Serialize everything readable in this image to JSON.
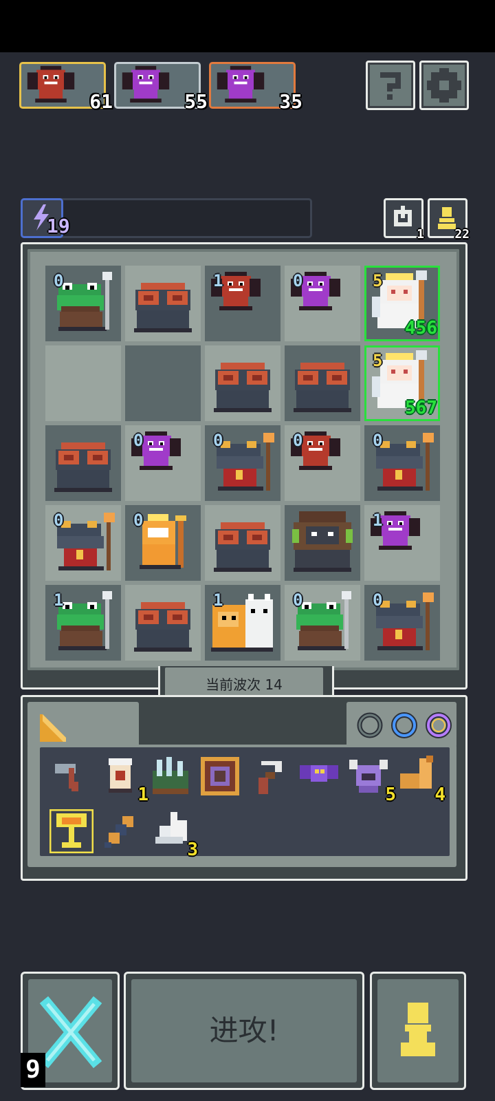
{
  "enemies": [
    {
      "count": "61",
      "ring": "#e7c24a",
      "type": "red-dragon"
    },
    {
      "count": "55",
      "ring": "#c3ccd1",
      "type": "purple-dragon"
    },
    {
      "count": "35",
      "ring": "#e27a3e",
      "type": "purple-dragon"
    }
  ],
  "top_buttons": {
    "help_icon": "question-icon",
    "settings_icon": "gear-icon"
  },
  "energy": {
    "value": "19",
    "icon": "lightning-icon"
  },
  "reroll": {
    "count": "1",
    "icon": "refresh-icon"
  },
  "pawns": {
    "count": "22",
    "icon": "pawn-icon"
  },
  "board": {
    "rows": [
      [
        {
          "unit": "green-frog",
          "lvl": "0"
        },
        {
          "unit": "red-toad"
        },
        {
          "unit": "red-dragon",
          "lvl": "1"
        },
        {
          "unit": "purple-dragon",
          "lvl": "0"
        },
        {
          "unit": "angel",
          "lvl": "5",
          "hp": "456"
        }
      ],
      [
        {
          "unit": "empty"
        },
        {
          "unit": "empty"
        },
        {
          "unit": "red-toad"
        },
        {
          "unit": "red-toad"
        },
        {
          "unit": "angel",
          "lvl": "5",
          "hp": "567"
        }
      ],
      [
        {
          "unit": "red-toad"
        },
        {
          "unit": "purple-dragon",
          "lvl": "0"
        },
        {
          "unit": "frog-mage",
          "lvl": "0"
        },
        {
          "unit": "red-dragon",
          "lvl": "0"
        },
        {
          "unit": "frog-mage",
          "lvl": "0"
        }
      ],
      [
        {
          "unit": "frog-mage",
          "lvl": "0"
        },
        {
          "unit": "cat-king",
          "lvl": "0"
        },
        {
          "unit": "red-toad"
        },
        {
          "unit": "rock-golem"
        },
        {
          "unit": "purple-dragon",
          "lvl": "1"
        }
      ],
      [
        {
          "unit": "green-frog",
          "lvl": "1"
        },
        {
          "unit": "red-toad"
        },
        {
          "unit": "lion-duo",
          "lvl": "1"
        },
        {
          "unit": "green-frog",
          "lvl": "0"
        },
        {
          "unit": "frog-mage",
          "lvl": "0"
        }
      ]
    ]
  },
  "wave_label": "当前波次 14",
  "inventory": {
    "tab_icon": "triangle-ruler-icon",
    "filter_icons": [
      "dark-ring-icon",
      "blue-ring-icon",
      "purple-ring-icon"
    ],
    "items": [
      {
        "icon": "hammer-icon",
        "count": ""
      },
      {
        "icon": "tower-icon",
        "count": "1"
      },
      {
        "icon": "crystal-field-icon",
        "count": ""
      },
      {
        "icon": "orb-frame-icon",
        "count": ""
      },
      {
        "icon": "slingshot-icon",
        "count": ""
      },
      {
        "icon": "bat-icon",
        "count": ""
      },
      {
        "icon": "horned-helm-icon",
        "count": "5"
      },
      {
        "icon": "horn-icon",
        "count": "4"
      },
      {
        "icon": "goblet-icon",
        "count": ""
      },
      {
        "icon": "feather-icon",
        "count": ""
      },
      {
        "icon": "wings-icon",
        "count": "3"
      }
    ]
  },
  "attack_label": "进攻!",
  "cancel_icon": "cross-swords-icon",
  "level_badge": "9",
  "pawn_button_icon": "pawn-icon",
  "colors": {
    "hp_green": "#29e03d",
    "lvl_blue": "#a7d3ee",
    "lvl_gold": "#f4d64a",
    "count_yellow": "#f4e02a"
  }
}
